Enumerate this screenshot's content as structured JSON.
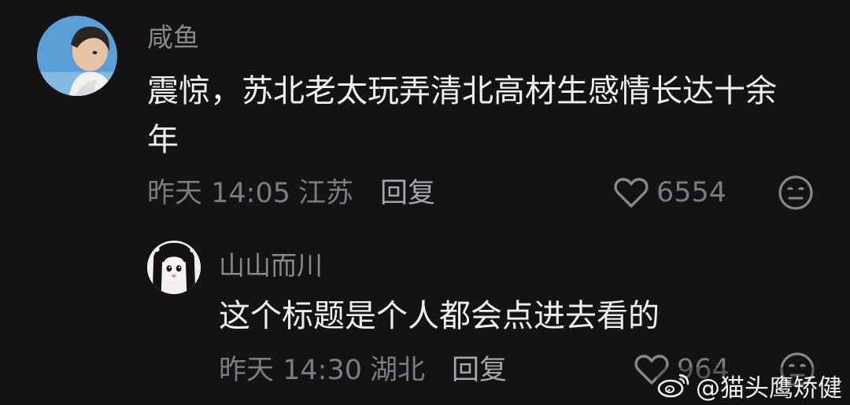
{
  "comment": {
    "username": "咸鱼",
    "content_line1": "震惊，苏北老太玩弄清北高材生感情长达十余",
    "content_line2": "年",
    "time": "昨天 14:05",
    "location": "江苏",
    "reply_label": "回复",
    "likes": "6554",
    "avatar_icon": "boy-portrait-avatar"
  },
  "reply": {
    "username": "山山而川",
    "content": "这个标题是个人都会点进去看的",
    "time": "昨天 14:30",
    "location": "湖北",
    "reply_label": "回复",
    "likes": "964",
    "avatar_icon": "anime-girl-avatar"
  },
  "watermark": {
    "text": "@猫头鹰矫健",
    "icon": "weibo-logo-icon"
  }
}
